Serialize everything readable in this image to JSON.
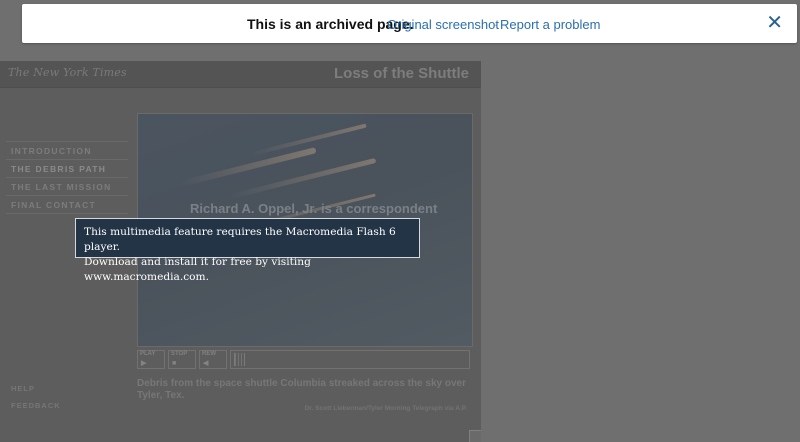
{
  "banner": {
    "message": "This is an archived page.",
    "original_screenshot": "Original screenshot",
    "separator": "·",
    "report_problem": "Report a problem",
    "close_glyph": "✕"
  },
  "flash_page": {
    "logo": "The New York Times",
    "title": "Loss of the Shuttle",
    "nav": [
      {
        "label": "INTRODUCTION"
      },
      {
        "label": "THE DEBRIS PATH"
      },
      {
        "label": "THE LAST MISSION"
      },
      {
        "label": "FINAL CONTACT"
      }
    ],
    "help": "HELP",
    "feedback": "FEEDBACK",
    "stage_caption": "Richard A. Oppel, Jr. is a correspondent",
    "controls": {
      "play": "PLAY",
      "stop": "STOP",
      "rew": "REW",
      "play_glyph": "▶",
      "stop_glyph": "■",
      "rew_glyph": "◀"
    },
    "photo_caption": "Debris from the space shuttle Columbia streaked across the sky over Tyler, Tex.",
    "credit": "Dr. Scott Lieberman/Tyler Morning Telegraph via A.P."
  },
  "notice": {
    "line1": "This multimedia feature requires the Macromedia Flash 6 player.",
    "line2": "Download and install it for free by visiting www.macromedia.com."
  },
  "colors": {
    "banner_link": "#2a6fb0",
    "notice_bg": "#243447",
    "overlay_bg": "#6f6f6f"
  }
}
